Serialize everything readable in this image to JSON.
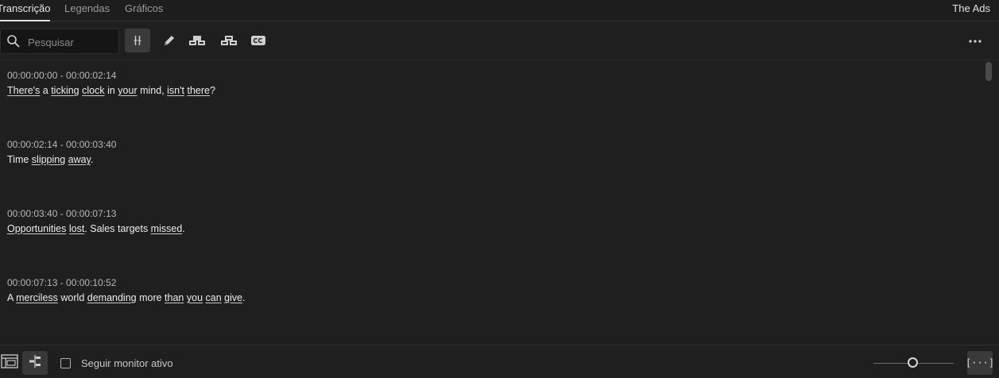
{
  "tabs": [
    {
      "label": "Transcrição",
      "active": true
    },
    {
      "label": "Legendas",
      "active": false
    },
    {
      "label": "Gráficos",
      "active": false
    }
  ],
  "project_title": "The Ads",
  "search": {
    "placeholder": "Pesquisar",
    "value": ""
  },
  "toolbar": {
    "tools": [
      {
        "icon": "split-segment-icon",
        "active": true
      },
      {
        "icon": "pencil-icon",
        "active": false
      },
      {
        "icon": "merge-up-icon",
        "active": false
      },
      {
        "icon": "merge-down-icon",
        "active": false
      },
      {
        "icon": "cc-icon",
        "active": false
      }
    ],
    "more_icon": "more-horizontal-icon"
  },
  "segments": [
    {
      "time": "00:00:00:00 - 00:00:02:14",
      "words": [
        {
          "t": "There's",
          "u": true
        },
        {
          "t": " a ",
          "u": false
        },
        {
          "t": "ticking",
          "u": true
        },
        {
          "t": " ",
          "u": false
        },
        {
          "t": "clock",
          "u": true
        },
        {
          "t": " in ",
          "u": false
        },
        {
          "t": "your",
          "u": true
        },
        {
          "t": " mind, ",
          "u": false
        },
        {
          "t": "isn't",
          "u": true
        },
        {
          "t": " ",
          "u": false
        },
        {
          "t": "there",
          "u": true
        },
        {
          "t": "?",
          "u": false
        }
      ]
    },
    {
      "time": "00:00:02:14 - 00:00:03:40",
      "words": [
        {
          "t": "Time ",
          "u": false
        },
        {
          "t": "slipping",
          "u": true
        },
        {
          "t": " ",
          "u": false
        },
        {
          "t": "away",
          "u": true
        },
        {
          "t": ".",
          "u": false
        }
      ]
    },
    {
      "time": "00:00:03:40 - 00:00:07:13",
      "words": [
        {
          "t": "Opportunities",
          "u": true
        },
        {
          "t": " ",
          "u": false
        },
        {
          "t": "lost",
          "u": true
        },
        {
          "t": ". Sales targets ",
          "u": false
        },
        {
          "t": "missed",
          "u": true
        },
        {
          "t": ".",
          "u": false
        }
      ]
    },
    {
      "time": "00:00:07:13 - 00:00:10:52",
      "words": [
        {
          "t": "A ",
          "u": false
        },
        {
          "t": "merciless",
          "u": true
        },
        {
          "t": " world ",
          "u": false
        },
        {
          "t": "demanding",
          "u": true
        },
        {
          "t": " more ",
          "u": false
        },
        {
          "t": "than",
          "u": true
        },
        {
          "t": " ",
          "u": false
        },
        {
          "t": "you",
          "u": true
        },
        {
          "t": " ",
          "u": false
        },
        {
          "t": "can",
          "u": true
        },
        {
          "t": " ",
          "u": false
        },
        {
          "t": "give",
          "u": true
        },
        {
          "t": ".",
          "u": false
        }
      ]
    }
  ],
  "footer": {
    "follow_monitor_label": "Seguir monitor ativo",
    "follow_monitor_checked": false,
    "caption_button_label": "[···]"
  },
  "colors": {
    "background": "#1f1f1f",
    "text": "#ececec",
    "timecode": "#b8b8b8"
  }
}
